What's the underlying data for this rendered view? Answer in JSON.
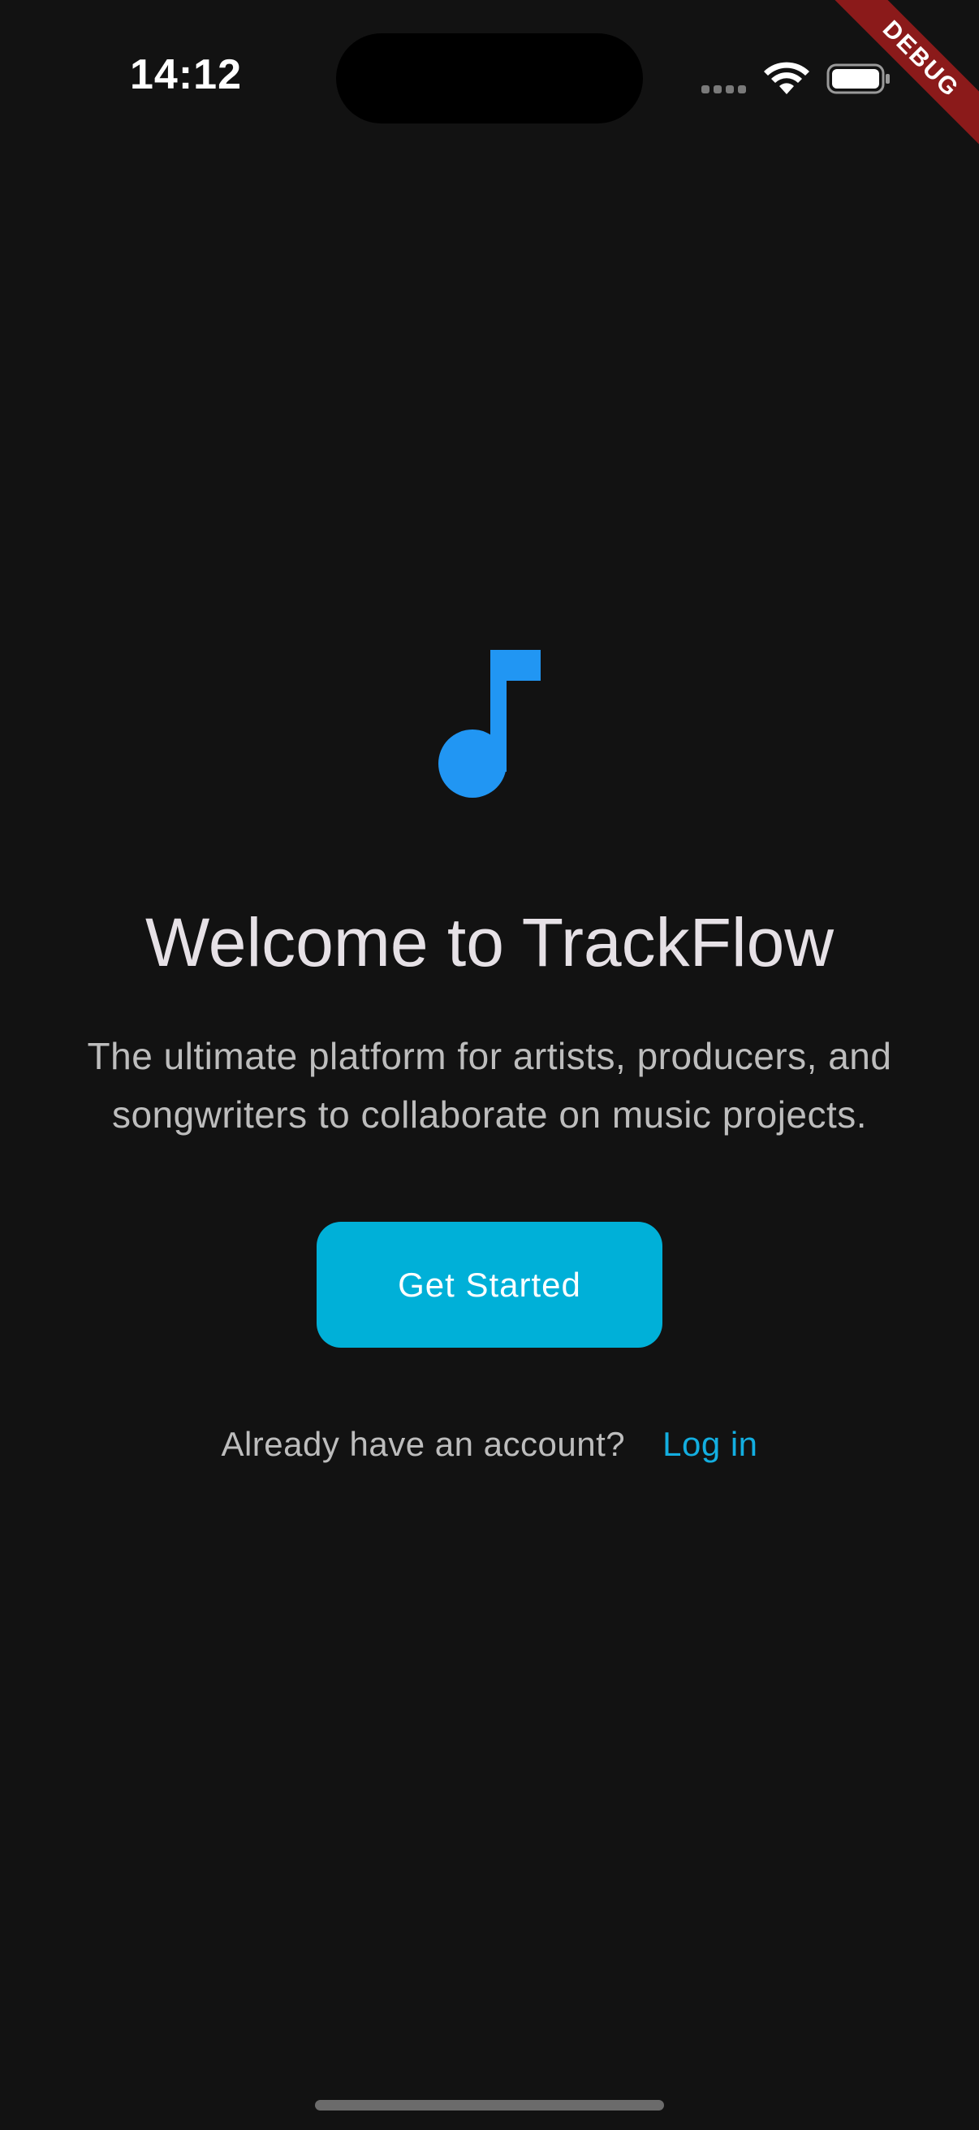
{
  "status_bar": {
    "time": "14:12",
    "icons": [
      "signal-dots-icon",
      "wifi-icon",
      "battery-icon"
    ]
  },
  "debug_banner": {
    "label": "DEBUG",
    "color": "#8b1a1a"
  },
  "welcome": {
    "logo_icon": "music-note-icon",
    "logo_color": "#2196f3",
    "title": "Welcome to TrackFlow",
    "subtitle_line1": "The ultimate platform for artists, producers, and",
    "subtitle_line2": "songwriters to collaborate on music projects.",
    "cta_label": "Get Started",
    "cta_color": "#00b0d8",
    "login_prompt": "Already have an account?",
    "login_link": "Log in",
    "link_color": "#13aee0"
  },
  "theme": {
    "background": "#121212"
  }
}
